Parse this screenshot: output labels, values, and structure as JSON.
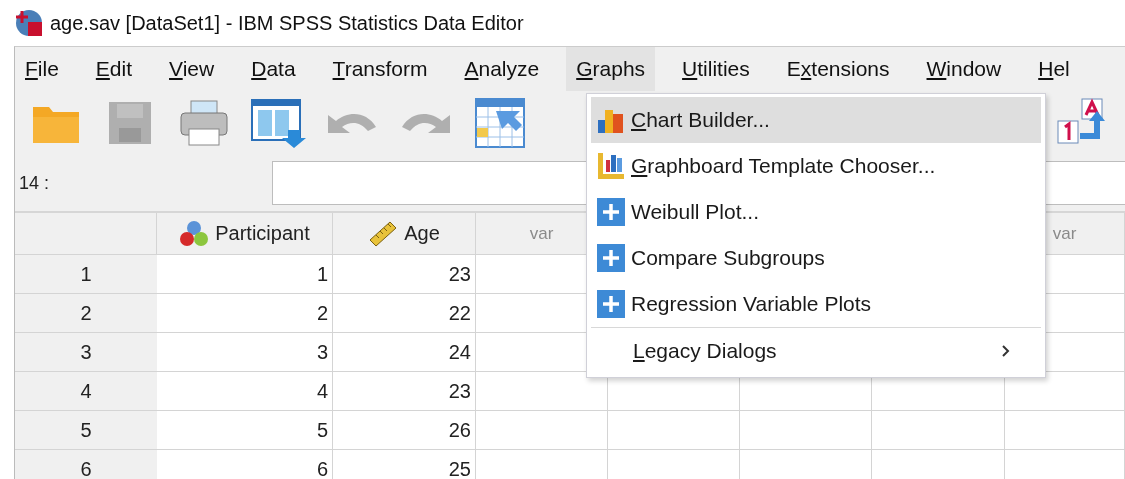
{
  "window": {
    "title": "age.sav [DataSet1] - IBM SPSS Statistics Data Editor"
  },
  "menu_bar": [
    {
      "key": "F",
      "post": "ile",
      "selected": false
    },
    {
      "key": "E",
      "post": "dit",
      "selected": false
    },
    {
      "key": "V",
      "post": "iew",
      "selected": false
    },
    {
      "key": "D",
      "post": "ata",
      "selected": false
    },
    {
      "key": "T",
      "post": "ransform",
      "selected": false
    },
    {
      "key": "A",
      "post": "nalyze",
      "selected": false
    },
    {
      "key": "G",
      "post": "raphs",
      "selected": true
    },
    {
      "key": "U",
      "post": "tilities",
      "selected": false
    },
    {
      "pre": "E",
      "key": "x",
      "post": "tensions",
      "selected": false
    },
    {
      "key": "W",
      "post": "indow",
      "selected": false
    },
    {
      "key": "H",
      "post": "el",
      "selected": false
    }
  ],
  "toolbar": [
    {
      "kind": "open",
      "disabled": false
    },
    {
      "kind": "save",
      "disabled": true
    },
    {
      "kind": "print",
      "disabled": false
    },
    {
      "kind": "dialog",
      "disabled": false
    },
    {
      "kind": "undo",
      "disabled": true
    },
    {
      "kind": "redo",
      "disabled": true
    },
    {
      "kind": "goto",
      "disabled": false
    },
    {
      "kind": "value-labels",
      "disabled": false
    }
  ],
  "cell_reference": {
    "label": "14 :"
  },
  "grid": {
    "columns": [
      {
        "name": "Participant",
        "kind": "nominal"
      },
      {
        "name": "Age",
        "kind": "scale"
      },
      {
        "name": "var",
        "kind": "empty"
      },
      {
        "kind": "empty"
      },
      {
        "kind": "empty"
      },
      {
        "kind": "empty"
      },
      {
        "name": "var",
        "kind": "empty"
      }
    ],
    "rows": [
      {
        "number": "1",
        "cells": [
          "1",
          "23"
        ]
      },
      {
        "number": "2",
        "cells": [
          "2",
          "22"
        ]
      },
      {
        "number": "3",
        "cells": [
          "3",
          "24"
        ]
      },
      {
        "number": "4",
        "cells": [
          "4",
          "23"
        ]
      },
      {
        "number": "5",
        "cells": [
          "5",
          "26"
        ]
      },
      {
        "number": "6",
        "cells": [
          "6",
          "25"
        ]
      }
    ]
  },
  "graphs_menu": [
    {
      "kind": "chart-builder",
      "key": "C",
      "post": "hart Builder...",
      "selected": true
    },
    {
      "kind": "graphboard",
      "key": "G",
      "post": "raphboard Template Chooser...",
      "selected": false
    },
    {
      "kind": "extension",
      "pre": "Weibull Plot...",
      "selected": false
    },
    {
      "kind": "extension",
      "pre": "Compare Subgroups",
      "selected": false
    },
    {
      "kind": "extension",
      "pre": "Regression Variable Plots",
      "selected": false
    },
    {
      "kind": "submenu",
      "key": "L",
      "post": "egacy Dialogs",
      "selected": false
    }
  ]
}
